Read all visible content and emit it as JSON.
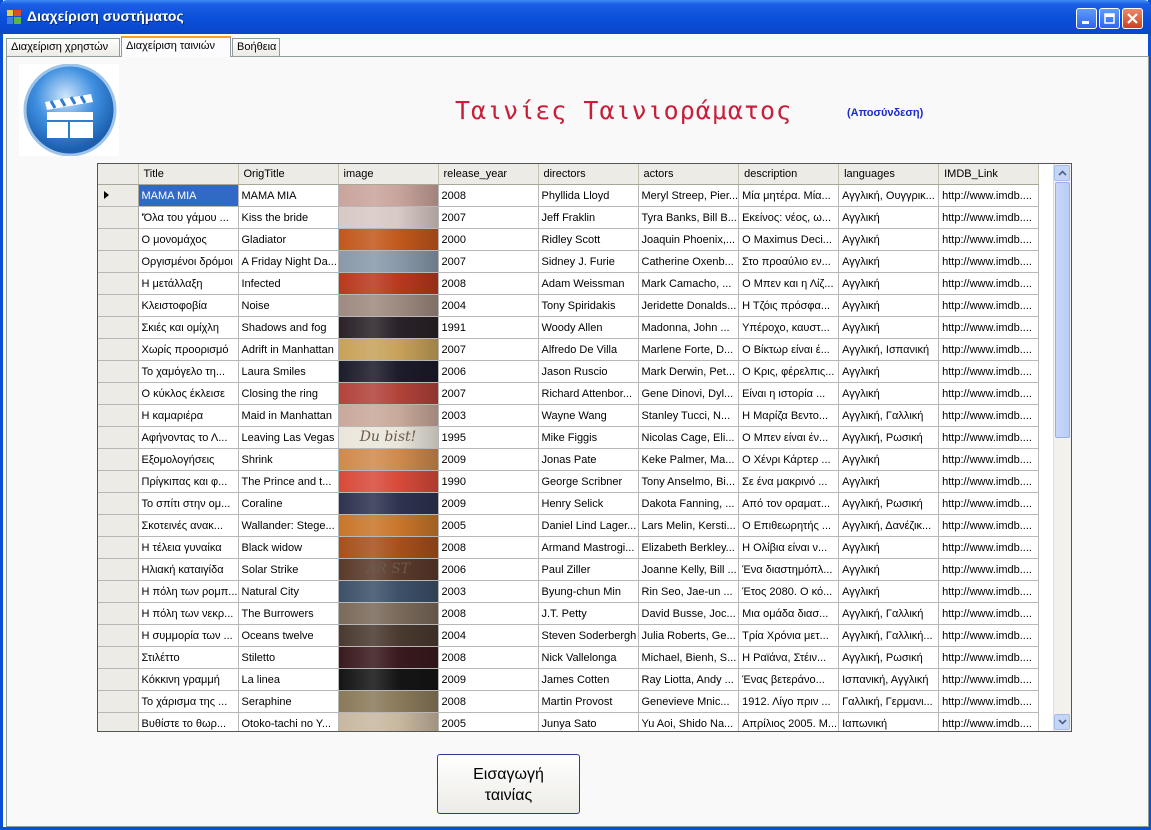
{
  "window": {
    "title": "Διαχείριση συστήματος"
  },
  "tabs": [
    {
      "label": "Διαχείριση χρηστών",
      "active": false
    },
    {
      "label": "Διαχείριση ταινιών",
      "active": true
    },
    {
      "label": "Βοήθεια",
      "active": false
    }
  ],
  "header": {
    "title": "Ταινίες Ταινιοράματος",
    "logout_label": "(Αποσύνδεση)"
  },
  "grid": {
    "columns": [
      "Title",
      "OrigTitle",
      "image",
      "release_year",
      "directors",
      "actors",
      "description",
      "languages",
      "IMDB_Link"
    ],
    "selected_row": 0,
    "rows": [
      {
        "title": "MAMA MIA",
        "orig": "MAMA MIA",
        "year": "2008",
        "directors": "Phyllida Lloyd",
        "actors": "Meryl Streep, Pier...",
        "description": "Μία μητέρα. Μία...",
        "languages": "Αγγλική, Ουγγρικ...",
        "imdb": "http://www.imdb....",
        "image_color": "#c9a49c"
      },
      {
        "title": "'Όλα του γάμου ...",
        "orig": "Kiss the bride",
        "year": "2007",
        "directors": "Jeff Fraklin",
        "actors": "Tyra Banks, Bill B...",
        "description": "Εκείνος: νέος, ω...",
        "languages": "Αγγλική",
        "imdb": "http://www.imdb....",
        "image_color": "#d7c9c4"
      },
      {
        "title": "Ο μονομάχος",
        "orig": "Gladiator",
        "year": "2000",
        "directors": "Ridley Scott",
        "actors": "Joaquin Phoenix,...",
        "description": "Ο Maximus Deci...",
        "languages": "Αγγλική",
        "imdb": "http://www.imdb....",
        "image_color": "#c2581c"
      },
      {
        "title": "Οργισμένοι δρόμοι",
        "orig": "A Friday Night Da...",
        "year": "2007",
        "directors": "Sidney J. Furie",
        "actors": "Catherine Oxenb...",
        "description": "Στο προαύλιο εν...",
        "languages": "Αγγλική",
        "imdb": "http://www.imdb....",
        "image_color": "#8899aa"
      },
      {
        "title": "Η μετάλλαξη",
        "orig": "Infected",
        "year": "2008",
        "directors": "Adam Weissman",
        "actors": "Mark Camacho, ...",
        "description": "Ο Μπεν και η Λίζ...",
        "languages": "Αγγλική",
        "imdb": "http://www.imdb....",
        "image_color": "#b8391e"
      },
      {
        "title": "Κλειστοφοβία",
        "orig": "Noise",
        "year": "2004",
        "directors": "Tony Spiridakis",
        "actors": "Jeridette Donalds...",
        "description": "Η Τζόις πρόσφα...",
        "languages": "Αγγλική",
        "imdb": "http://www.imdb....",
        "image_color": "#9e8a80"
      },
      {
        "title": "Σκιές και ομίχλη",
        "orig": "Shadows and fog",
        "year": "1991",
        "directors": "Woody Allen",
        "actors": "Madonna, John ...",
        "description": "Υπέροχο, καυστ...",
        "languages": "Αγγλική",
        "imdb": "http://www.imdb....",
        "image_color": "#2a2228"
      },
      {
        "title": "Χωρίς προορισμό",
        "orig": "Adrift in Manhattan",
        "year": "2007",
        "directors": "Alfredo De Villa",
        "actors": "Marlene Forte, D...",
        "description": "Ο Βίκτωρ είναι έ...",
        "languages": "Αγγλική, Ισπανική",
        "imdb": "http://www.imdb....",
        "image_color": "#c7a25a"
      },
      {
        "title": "Το χαμόγελο τη...",
        "orig": "Laura Smiles",
        "year": "2006",
        "directors": "Jason Ruscio",
        "actors": "Mark Derwin, Pet...",
        "description": "Ο Κρις, φέρελπις...",
        "languages": "Αγγλική",
        "imdb": "http://www.imdb....",
        "image_color": "#1c1c2a"
      },
      {
        "title": "Ο κύκλος έκλεισε",
        "orig": "Closing the ring",
        "year": "2007",
        "directors": "Richard Attenbor...",
        "actors": "Gene Dinovi, Dyl...",
        "description": "Είναι η ιστορία ...",
        "languages": "Αγγλική",
        "imdb": "http://www.imdb....",
        "image_color": "#b2433a"
      },
      {
        "title": "Η καμαριέρα",
        "orig": "Maid in Manhattan",
        "year": "2003",
        "directors": "Wayne Wang",
        "actors": "Stanley Tucci, N...",
        "description": "Η Μαρίζα Βεντο...",
        "languages": "Αγγλική, Γαλλική",
        "imdb": "http://www.imdb....",
        "image_color": "#c8a99a"
      },
      {
        "title": "Αφήνοντας το Λ...",
        "orig": "Leaving Las Vegas",
        "year": "1995",
        "directors": "Mike Figgis",
        "actors": "Nicolas Cage, Eli...",
        "description": "Ο Μπεν είναι έν...",
        "languages": "Αγγλική, Ρωσική",
        "imdb": "http://www.imdb....",
        "image_color": "#eae6dc",
        "image_text": "Du bist!"
      },
      {
        "title": "Εξομολογήσεις",
        "orig": "Shrink",
        "year": "2009",
        "directors": "Jonas Pate",
        "actors": "Keke Palmer, Ma...",
        "description": "Ο Χένρι Κάρτερ ...",
        "languages": "Αγγλική",
        "imdb": "http://www.imdb....",
        "image_color": "#d08a4c"
      },
      {
        "title": "Πρίγκιπας και φ...",
        "orig": "The Prince and t...",
        "year": "1990",
        "directors": "George Scribner",
        "actors": "Tony Anselmo, Bi...",
        "description": "Σε ένα μακρινό ...",
        "languages": "Αγγλική",
        "imdb": "http://www.imdb....",
        "image_color": "#d84a3a"
      },
      {
        "title": "Το σπίτι στην ομ...",
        "orig": "Coraline",
        "year": "2009",
        "directors": "Henry Selick",
        "actors": "Dakota Fanning, ...",
        "description": "Από τον οραματ...",
        "languages": "Αγγλική, Ρωσική",
        "imdb": "http://www.imdb....",
        "image_color": "#2e3350"
      },
      {
        "title": "Σκοτεινές ανακ...",
        "orig": "Wallander: Stege...",
        "year": "2005",
        "directors": "Daniel Lind Lager...",
        "actors": "Lars Melin, Kersti...",
        "description": "Ο Επιθεωρητής ...",
        "languages": "Αγγλική, Δανέζικ...",
        "imdb": "http://www.imdb....",
        "image_color": "#c9762a"
      },
      {
        "title": "Η τέλεια γυναίκα",
        "orig": "Black widow",
        "year": "2008",
        "directors": "Armand Mastrogi...",
        "actors": "Elizabeth Berkley...",
        "description": "Η Ολίβια είναι ν...",
        "languages": "Αγγλική",
        "imdb": "http://www.imdb....",
        "image_color": "#a8501c"
      },
      {
        "title": "Ηλιακή καταιγίδα",
        "orig": "Solar Strike",
        "year": "2006",
        "directors": "Paul Ziller",
        "actors": "Joanne Kelly, Bill ...",
        "description": "Ένα διαστημόπλ...",
        "languages": "Αγγλική",
        "imdb": "http://www.imdb....",
        "image_color": "#5a3a2a",
        "image_text": "AR ST"
      },
      {
        "title": "Η πόλη των ρομπ...",
        "orig": "Natural City",
        "year": "2003",
        "directors": "Byung-chun Min",
        "actors": "Rin Seo, Jae-un ...",
        "description": "Έτος 2080. Ο κό...",
        "languages": "Αγγλική",
        "imdb": "http://www.imdb....",
        "image_color": "#3d5168"
      },
      {
        "title": "Η πόλη των νεκρ...",
        "orig": "The Burrowers",
        "year": "2008",
        "directors": "J.T. Petty",
        "actors": "David Busse, Joc...",
        "description": "Μια ομάδα διασ...",
        "languages": "Αγγλική, Γαλλική",
        "imdb": "http://www.imdb....",
        "image_color": "#7a6a5a"
      },
      {
        "title": "Η συμμορία των ...",
        "orig": "Oceans twelve",
        "year": "2004",
        "directors": "Steven Soderbergh",
        "actors": "Julia Roberts, Ge...",
        "description": "Τρία Χρόνια μετ...",
        "languages": "Αγγλική, Γαλλική...",
        "imdb": "http://www.imdb....",
        "image_color": "#4a3a30"
      },
      {
        "title": "Στιλέττο",
        "orig": "Stiletto",
        "year": "2008",
        "directors": "Nick Vallelonga",
        "actors": "Michael, Bienh, S...",
        "description": "Η Ραϊάνα, Στέιν...",
        "languages": "Αγγλική, Ρωσική",
        "imdb": "http://www.imdb....",
        "image_color": "#3a1a1e"
      },
      {
        "title": "Κόκκινη γραμμή",
        "orig": "La linea",
        "year": "2009",
        "directors": "James Cotten",
        "actors": "Ray Liotta, Andy ...",
        "description": "Ένας βετεράνο...",
        "languages": "Ισπανική, Αγγλική",
        "imdb": "http://www.imdb....",
        "image_color": "#151515"
      },
      {
        "title": "Το χάρισμα της ...",
        "orig": "Seraphine",
        "year": "2008",
        "directors": "Martin Provost",
        "actors": "Genevieve Mnic...",
        "description": "1912. Λίγο πριν ...",
        "languages": "Γαλλική, Γερμανι...",
        "imdb": "http://www.imdb....",
        "image_color": "#8a7a5a"
      },
      {
        "title": "Βυθίστε το θωρ...",
        "orig": "Otoko-tachi no Y...",
        "year": "2005",
        "directors": "Junya Sato",
        "actors": "Yu Aoi, Shido Na...",
        "description": "Απρίλιος 2005. Μ...",
        "languages": "Ιαπωνική",
        "imdb": "http://www.imdb....",
        "image_color": "#c8b8a0"
      }
    ]
  },
  "insert_button": {
    "line1": "Εισαγωγή",
    "line2": "ταινίας"
  },
  "colors": {
    "heading": "#c81e3a",
    "logout": "#1b2cc8",
    "selection": "#316ac5",
    "titlebar": "#0b4fd8",
    "tab_highlight": "#f7a41c"
  }
}
